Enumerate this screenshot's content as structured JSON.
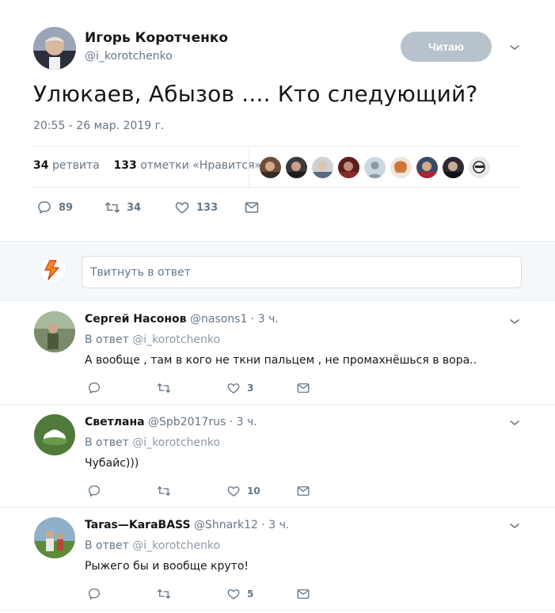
{
  "tweet": {
    "author_name": "Игорь Коротченко",
    "author_handle": "@i_korotchenko",
    "follow_label": "Читаю",
    "text": "Улюкаев, Абызов .... Кто следующий?",
    "timestamp": "20:55 - 26 мар. 2019 г.",
    "retweets_count": "34",
    "retweets_label": "ретвита",
    "likes_count": "133",
    "likes_label": "отметки «Нравится»",
    "likers_avatar_count": 9,
    "actions": {
      "replies": "89",
      "retweets": "34",
      "likes": "133"
    }
  },
  "reply_box": {
    "placeholder": "Твитнуть в ответ"
  },
  "replies": [
    {
      "name": "Сергей Насонов",
      "handle": "@nasons1",
      "time": "· 3 ч.",
      "in_reply_prefix": "В ответ",
      "in_reply_handle": "@i_korotchenko",
      "text": "А вообще , там в кого не ткни пальцем , не промахнёшься в вора..",
      "likes": "3"
    },
    {
      "name": "Светлана",
      "handle": "@Spb2017rus",
      "time": "· 3 ч.",
      "in_reply_prefix": "В ответ",
      "in_reply_handle": "@i_korotchenko",
      "text": "Чубайс)))",
      "likes": "10"
    },
    {
      "name": "Taras—KaraBASS",
      "handle": "@Shnark12",
      "time": "· 3 ч.",
      "in_reply_prefix": "В ответ",
      "in_reply_handle": "@i_korotchenko",
      "text": "Рыжего бы и вообще круто!",
      "likes": "5"
    }
  ],
  "colors": {
    "primary_text": "#14171a",
    "secondary_text": "#657786",
    "follow_button": "#b7c2cc",
    "divider": "#e6ecf0",
    "reply_bg": "#f5f8fa"
  },
  "icons": [
    "chevron-down-icon",
    "reply-icon",
    "retweet-icon",
    "like-icon",
    "dm-icon"
  ]
}
